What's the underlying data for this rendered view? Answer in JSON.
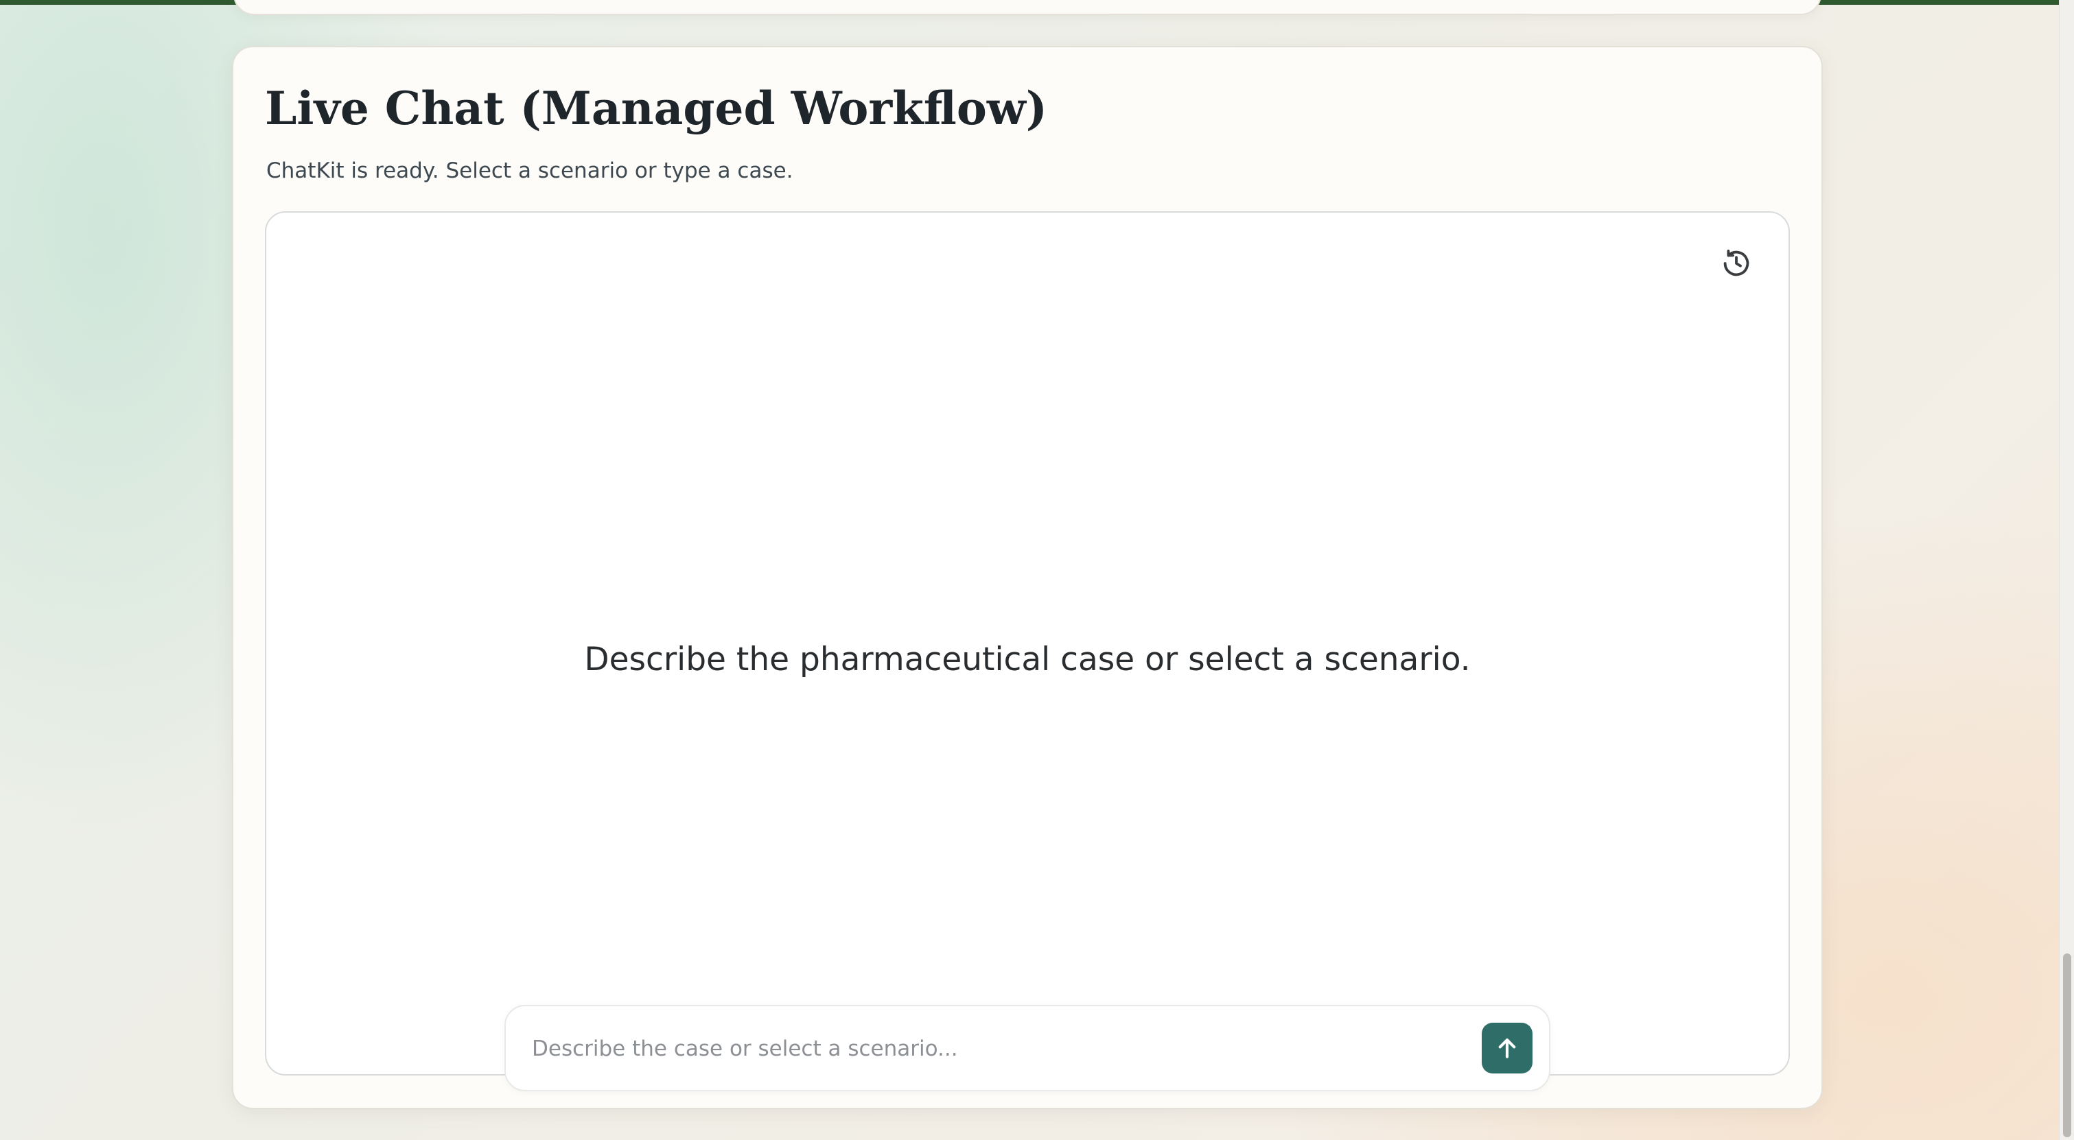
{
  "live_chat": {
    "title": "Live Chat (Managed Workflow)",
    "status_text": "ChatKit is ready. Select a scenario or type a case.",
    "history_icon": "history-icon",
    "empty_state_text": "Describe the pharmaceutical case or select a scenario.",
    "composer": {
      "placeholder": "Describe the case or select a scenario...",
      "value": "",
      "send_icon": "arrow-up-icon"
    }
  },
  "colors": {
    "accent": "#2f6e68",
    "top_strip": "#2f5a2f",
    "title_text": "#1f262b",
    "card_background": "#fdfcf8"
  }
}
